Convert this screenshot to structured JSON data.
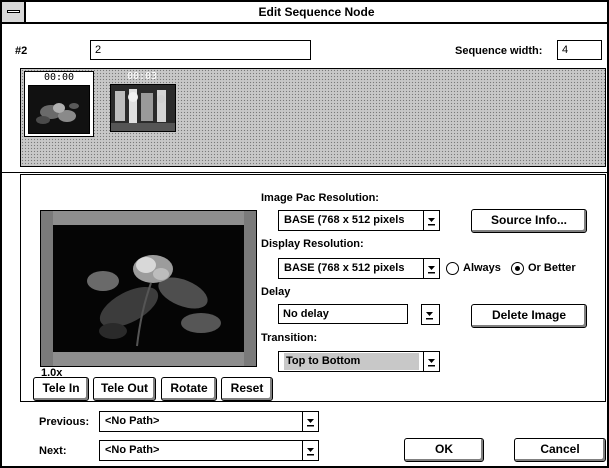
{
  "window": {
    "title": "Edit Sequence Node"
  },
  "header": {
    "node_label": "#2",
    "node_name_value": "2",
    "sequence_width_label": "Sequence width:",
    "sequence_width_value": "4"
  },
  "strip": {
    "thumbnails": [
      {
        "timestamp": "00:00",
        "selected": true
      },
      {
        "timestamp": "00:03",
        "selected": false
      }
    ]
  },
  "image_pac_resolution": {
    "label": "Image Pac Resolution:",
    "value": "BASE (768 x 512 pixels"
  },
  "display_resolution": {
    "label": "Display Resolution:",
    "value": "BASE (768 x 512 pixels",
    "always_label": "Always",
    "or_better_label": "Or Better",
    "selected_option": "Or Better"
  },
  "delay": {
    "label": "Delay",
    "value": "No delay"
  },
  "transition": {
    "label": "Transition:",
    "value": "Top to Bottom"
  },
  "buttons": {
    "source_info": "Source Info...",
    "delete_image": "Delete Image",
    "tele_in": "Tele In",
    "tele_out": "Tele Out",
    "rotate": "Rotate",
    "reset": "Reset",
    "ok": "OK",
    "cancel": "Cancel"
  },
  "zoom": "1.0x",
  "navigation": {
    "previous_label": "Previous:",
    "previous_value": "<No Path>",
    "next_label": "Next:",
    "next_value": "<No Path>"
  },
  "icons": {
    "system_menu": "system-menu-icon",
    "dropdown_arrow": "dropdown-arrow-icon"
  },
  "colors": {
    "background": "#ffffff",
    "strip_background": "#c8c8c8",
    "text": "#000000"
  }
}
